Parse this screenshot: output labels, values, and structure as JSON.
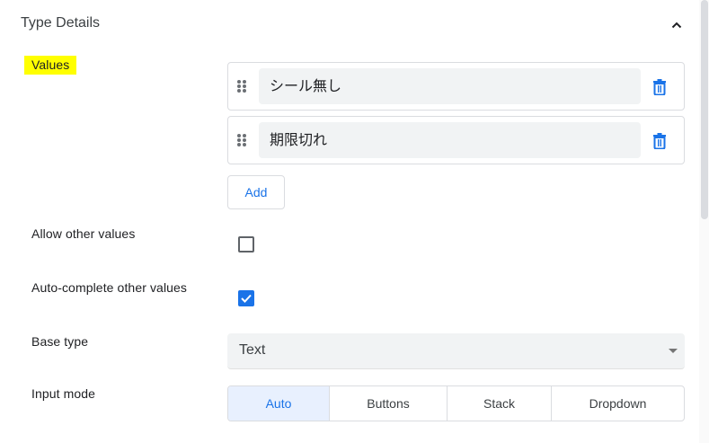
{
  "section": {
    "title": "Type Details",
    "collapse_icon": "chevron-up-icon"
  },
  "values": {
    "label": "Values",
    "items": [
      {
        "value": "シール無し"
      },
      {
        "value": "期限切れ"
      }
    ],
    "add_label": "Add"
  },
  "allow_other": {
    "label": "Allow other values",
    "checked": false
  },
  "auto_complete": {
    "label": "Auto-complete other values",
    "checked": true
  },
  "base_type": {
    "label": "Base type",
    "value": "Text"
  },
  "input_mode": {
    "label": "Input mode",
    "options": [
      "Auto",
      "Buttons",
      "Stack",
      "Dropdown"
    ],
    "selected": "Auto"
  },
  "colors": {
    "accent": "#1a73e8",
    "highlight": "#ffff00",
    "field_bg": "#f1f3f4",
    "border": "#dadce0"
  }
}
